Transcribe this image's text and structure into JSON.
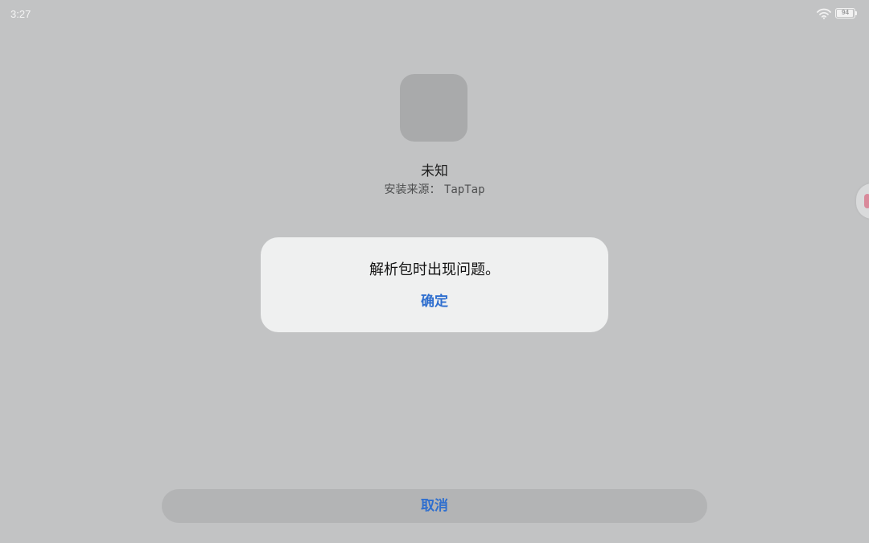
{
  "status_bar": {
    "time": "3:27",
    "battery_level": "94",
    "icons": [
      "wifi-icon",
      "battery-icon"
    ]
  },
  "app": {
    "name": "未知",
    "source_label": "安装来源：",
    "source_value": "TapTap"
  },
  "dialog": {
    "message": "解析包时出现问题。",
    "ok_label": "确定"
  },
  "footer": {
    "cancel_label": "取消"
  },
  "colors": {
    "background": "#c2c3c4",
    "dialog_background": "#eff0f0",
    "accent": "#2f6fcf"
  }
}
